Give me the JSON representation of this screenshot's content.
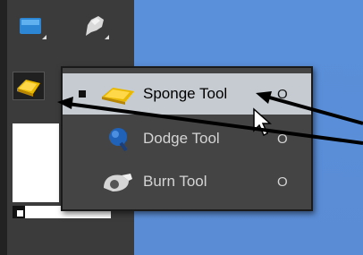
{
  "menu": {
    "items": [
      {
        "label": "Sponge Tool",
        "shortcut": "O",
        "selected": true
      },
      {
        "label": "Dodge Tool",
        "shortcut": "O",
        "selected": false
      },
      {
        "label": "Burn Tool",
        "shortcut": "O",
        "selected": false
      }
    ]
  },
  "icons": {
    "tool_1": "blur-tool-icon",
    "tool_2": "smudge-tool-icon",
    "tool_active": "sponge-tool-icon",
    "menu_1": "sponge-tool-icon",
    "menu_2": "dodge-tool-icon",
    "menu_3": "burn-tool-icon"
  },
  "colors": {
    "canvas": "#5b8ed6",
    "toolbar": "#3b3b3b",
    "menu_bg": "#444444",
    "menu_highlight": "#c5cbd1"
  }
}
